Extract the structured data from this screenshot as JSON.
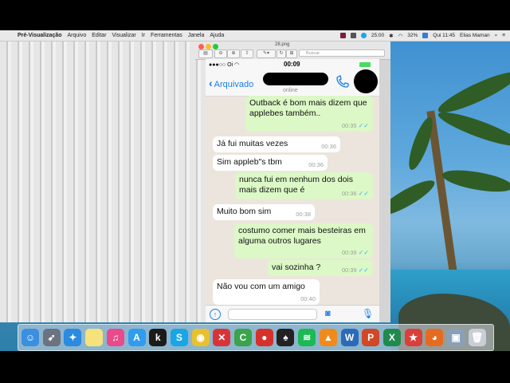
{
  "menubar": {
    "app_name": "Pré-Visualização",
    "menus": [
      "Arquivo",
      "Editar",
      "Visualizar",
      "Ir",
      "Ferramentas",
      "Janela",
      "Ajuda"
    ],
    "timer": "25:00",
    "battery": "32%",
    "clock": "Qui 11:45",
    "user": "Elias Maman"
  },
  "preview": {
    "filename": "28.png",
    "search_placeholder": "Buscar"
  },
  "phone": {
    "carrier": "Oi",
    "clock": "00:09",
    "back_label": "Arquivado",
    "contact_status": "online",
    "messages": [
      {
        "dir": "out",
        "text": "Outback é bom mais dizem que applebes também..",
        "time": "00:35"
      },
      {
        "dir": "in",
        "text": "Já fui muitas vezes",
        "time": "00:36"
      },
      {
        "dir": "in",
        "text": "Sim appleb\"s tbm",
        "time": "00:36"
      },
      {
        "dir": "out",
        "text": "nunca fui em nenhum dos dois mais dizem que é",
        "time": "00:36"
      },
      {
        "dir": "in",
        "text": "Muito bom sim",
        "time": "00:38"
      },
      {
        "dir": "out",
        "text": "costumo comer mais besteiras em alguma outros lugares",
        "time": "00:39"
      },
      {
        "dir": "out",
        "text": "vai sozinha ?",
        "time": "00:39"
      },
      {
        "dir": "in",
        "text": "Não vou com um amigo",
        "time": "00:40"
      }
    ]
  },
  "dock": {
    "items": [
      {
        "name": "finder-icon",
        "glyph": "☺",
        "color": "#3b8fe0"
      },
      {
        "name": "launchpad-icon",
        "glyph": "➶",
        "color": "#6b7280"
      },
      {
        "name": "safari-icon",
        "glyph": "✦",
        "color": "#2a8be0"
      },
      {
        "name": "notes-icon",
        "glyph": "",
        "color": "#f5e27a"
      },
      {
        "name": "itunes-icon",
        "glyph": "♫",
        "color": "#e94b8a"
      },
      {
        "name": "app-store-icon",
        "glyph": "A",
        "color": "#2f9cf0"
      },
      {
        "name": "kindle-icon",
        "glyph": "k",
        "color": "#1b1b1b"
      },
      {
        "name": "skype-icon",
        "glyph": "S",
        "color": "#19a5e6"
      },
      {
        "name": "chrome-icon",
        "glyph": "◉",
        "color": "#e8c12e"
      },
      {
        "name": "crossover-icon",
        "glyph": "✕",
        "color": "#d9333a"
      },
      {
        "name": "camtasia-icon",
        "glyph": "C",
        "color": "#3aa34b"
      },
      {
        "name": "tomato-icon",
        "glyph": "●",
        "color": "#d6302a"
      },
      {
        "name": "poker-icon",
        "glyph": "♠",
        "color": "#222222"
      },
      {
        "name": "spotify-icon",
        "glyph": "≋",
        "color": "#1db954"
      },
      {
        "name": "vlc-icon",
        "glyph": "▲",
        "color": "#f08a1c"
      },
      {
        "name": "word-icon",
        "glyph": "W",
        "color": "#2b6ab8"
      },
      {
        "name": "powerpoint-icon",
        "glyph": "P",
        "color": "#d24726"
      },
      {
        "name": "excel-icon",
        "glyph": "X",
        "color": "#1f8a4c"
      },
      {
        "name": "wunderlist-icon",
        "glyph": "★",
        "color": "#d9403a"
      },
      {
        "name": "firefox-icon",
        "glyph": "◕",
        "color": "#e66b20"
      },
      {
        "name": "preview-icon",
        "glyph": "▣",
        "color": "#8aa0b8"
      },
      {
        "name": "trash-icon",
        "glyph": "🗑",
        "color": "#c9ced6"
      }
    ]
  }
}
